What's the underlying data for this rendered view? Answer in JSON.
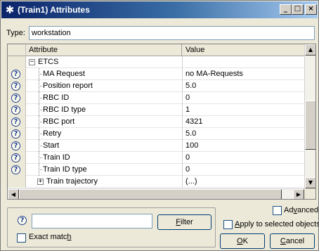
{
  "window": {
    "title": "(Train1) Attributes",
    "icon": "asterisk-icon",
    "minimize_glyph": "_",
    "maximize_glyph": "□",
    "close_glyph": "×"
  },
  "type_field": {
    "label": "Type:",
    "value": "workstation"
  },
  "grid": {
    "headers": {
      "attribute": "Attribute",
      "value": "Value"
    },
    "group_label": "ETCS",
    "group_expander": "⊟",
    "rows": [
      {
        "attribute": "MA Request",
        "value": "no MA-Requests"
      },
      {
        "attribute": "Position report",
        "value": "5.0"
      },
      {
        "attribute": "RBC ID",
        "value": "0"
      },
      {
        "attribute": "RBC ID type",
        "value": "1"
      },
      {
        "attribute": "RBC port",
        "value": "4321"
      },
      {
        "attribute": "Retry",
        "value": "5.0"
      },
      {
        "attribute": "Start",
        "value": "100"
      },
      {
        "attribute": "Train ID",
        "value": "0"
      },
      {
        "attribute": "Train ID type",
        "value": "0"
      }
    ],
    "child_group": {
      "expander": "⊞",
      "attribute": "Train trajectory",
      "value": "(...)"
    },
    "help_glyph": "?"
  },
  "filter": {
    "help_glyph": "?",
    "input_value": "",
    "button_label_pre": "",
    "button_label_u": "F",
    "button_label_post": "ilter",
    "exact_match_pre": "Exact matc",
    "exact_match_u": "h",
    "exact_match_checked": false
  },
  "options": {
    "advanced_pre": "Ad",
    "advanced_u": "v",
    "advanced_post": "anced",
    "advanced_checked": false,
    "apply_pre": "",
    "apply_u": "A",
    "apply_post": "pply to selected objects",
    "apply_checked": false
  },
  "buttons": {
    "ok_u": "O",
    "ok_post": "K",
    "cancel_pre": "",
    "cancel_u": "C",
    "cancel_post": "ancel"
  },
  "colors": {
    "titlebar_start": "#0a246a",
    "titlebar_end": "#a6caf0",
    "dialog_bg": "#ece9d8",
    "help_icon": "#1e3c8c"
  }
}
